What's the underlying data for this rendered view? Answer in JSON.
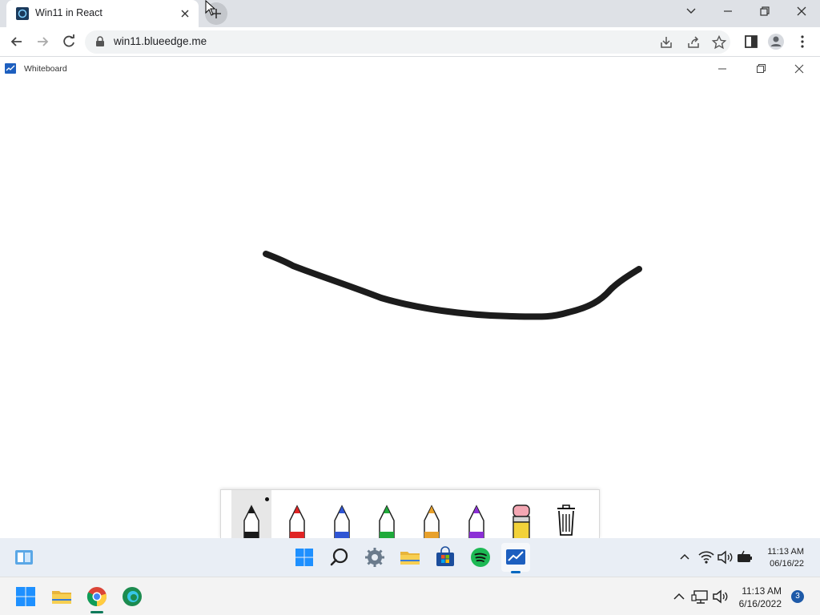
{
  "browser": {
    "tab_title": "Win11 in React",
    "url": "win11.blueedge.me"
  },
  "app": {
    "title": "Whiteboard"
  },
  "pens": [
    {
      "name": "black",
      "color": "#1a1a1a",
      "selected": true
    },
    {
      "name": "red",
      "color": "#e02424"
    },
    {
      "name": "blue",
      "color": "#2f55d4"
    },
    {
      "name": "green",
      "color": "#1faa3a"
    },
    {
      "name": "orange",
      "color": "#e8a12b"
    },
    {
      "name": "purple",
      "color": "#8b2fd6"
    },
    {
      "name": "eraser",
      "color": "#f2d23a"
    },
    {
      "name": "trash",
      "color": "#111111"
    }
  ],
  "inner_taskbar": {
    "time": "11:13 AM",
    "date": "06/16/22",
    "apps": [
      "widgets-icon",
      "start-icon",
      "search-icon",
      "settings-icon",
      "file-explorer-icon",
      "store-icon",
      "spotify-icon",
      "whiteboard-icon"
    ]
  },
  "host_taskbar": {
    "time": "11:13 AM",
    "date": "6/16/2022",
    "notification_count": "3",
    "apps": [
      "windows-start-icon",
      "file-explorer-icon",
      "chrome-icon",
      "edge-icon"
    ]
  },
  "colors": {
    "stroke": "#1c1c1c",
    "accent": "#0067c0"
  }
}
